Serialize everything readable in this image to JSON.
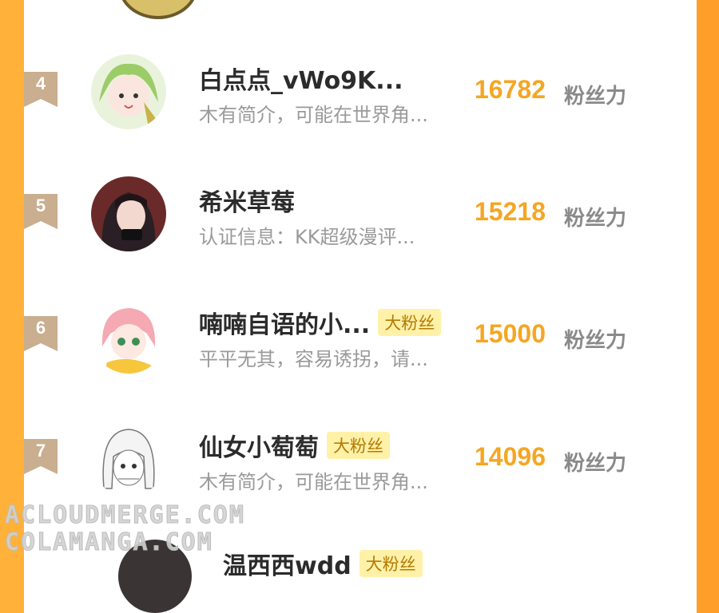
{
  "score_unit": "粉丝力",
  "colors": {
    "accent": "#f5a623",
    "badge_bg": "#fff1a8",
    "rank_badge": "#c9ae8f"
  },
  "rows": [
    {
      "rank": "4",
      "name": "白点点_vWo9K...",
      "badge": "",
      "bio": "木有简介，可能在世界角...",
      "score": "16782"
    },
    {
      "rank": "5",
      "name": "希米草莓",
      "badge": "",
      "bio": "认证信息：KK超级漫评...",
      "score": "15218"
    },
    {
      "rank": "6",
      "name": "喃喃自语的小...",
      "badge": "大粉丝",
      "bio": "平平无其，容易诱拐，请...",
      "score": "15000"
    },
    {
      "rank": "7",
      "name": "仙女小萄萄",
      "badge": "大粉丝",
      "bio": "木有简介，可能在世界角...",
      "score": "14096"
    }
  ],
  "partial_next": {
    "name": "温西西wdd",
    "badge": "大粉丝"
  },
  "watermarks": [
    "ACLOUDMERGE.COM",
    "COLAMANGA.COM"
  ]
}
